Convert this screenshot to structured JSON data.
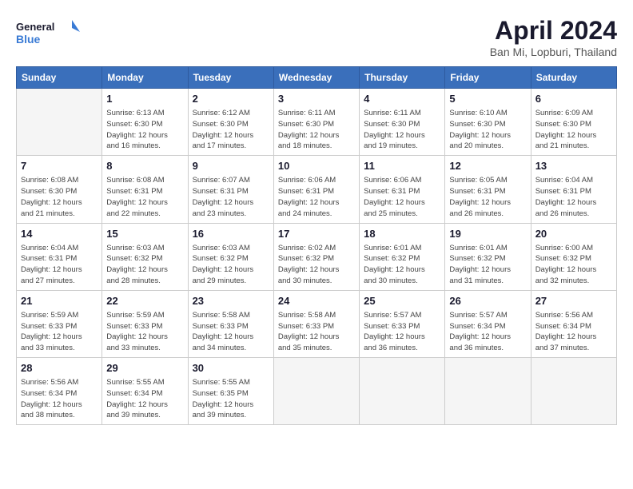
{
  "header": {
    "logo_line1": "General",
    "logo_line2": "Blue",
    "month_title": "April 2024",
    "location": "Ban Mi, Lopburi, Thailand"
  },
  "weekdays": [
    "Sunday",
    "Monday",
    "Tuesday",
    "Wednesday",
    "Thursday",
    "Friday",
    "Saturday"
  ],
  "weeks": [
    [
      {
        "day": "",
        "info": ""
      },
      {
        "day": "1",
        "info": "Sunrise: 6:13 AM\nSunset: 6:30 PM\nDaylight: 12 hours\nand 16 minutes."
      },
      {
        "day": "2",
        "info": "Sunrise: 6:12 AM\nSunset: 6:30 PM\nDaylight: 12 hours\nand 17 minutes."
      },
      {
        "day": "3",
        "info": "Sunrise: 6:11 AM\nSunset: 6:30 PM\nDaylight: 12 hours\nand 18 minutes."
      },
      {
        "day": "4",
        "info": "Sunrise: 6:11 AM\nSunset: 6:30 PM\nDaylight: 12 hours\nand 19 minutes."
      },
      {
        "day": "5",
        "info": "Sunrise: 6:10 AM\nSunset: 6:30 PM\nDaylight: 12 hours\nand 20 minutes."
      },
      {
        "day": "6",
        "info": "Sunrise: 6:09 AM\nSunset: 6:30 PM\nDaylight: 12 hours\nand 21 minutes."
      }
    ],
    [
      {
        "day": "7",
        "info": "Sunrise: 6:08 AM\nSunset: 6:30 PM\nDaylight: 12 hours\nand 21 minutes."
      },
      {
        "day": "8",
        "info": "Sunrise: 6:08 AM\nSunset: 6:31 PM\nDaylight: 12 hours\nand 22 minutes."
      },
      {
        "day": "9",
        "info": "Sunrise: 6:07 AM\nSunset: 6:31 PM\nDaylight: 12 hours\nand 23 minutes."
      },
      {
        "day": "10",
        "info": "Sunrise: 6:06 AM\nSunset: 6:31 PM\nDaylight: 12 hours\nand 24 minutes."
      },
      {
        "day": "11",
        "info": "Sunrise: 6:06 AM\nSunset: 6:31 PM\nDaylight: 12 hours\nand 25 minutes."
      },
      {
        "day": "12",
        "info": "Sunrise: 6:05 AM\nSunset: 6:31 PM\nDaylight: 12 hours\nand 26 minutes."
      },
      {
        "day": "13",
        "info": "Sunrise: 6:04 AM\nSunset: 6:31 PM\nDaylight: 12 hours\nand 26 minutes."
      }
    ],
    [
      {
        "day": "14",
        "info": "Sunrise: 6:04 AM\nSunset: 6:31 PM\nDaylight: 12 hours\nand 27 minutes."
      },
      {
        "day": "15",
        "info": "Sunrise: 6:03 AM\nSunset: 6:32 PM\nDaylight: 12 hours\nand 28 minutes."
      },
      {
        "day": "16",
        "info": "Sunrise: 6:03 AM\nSunset: 6:32 PM\nDaylight: 12 hours\nand 29 minutes."
      },
      {
        "day": "17",
        "info": "Sunrise: 6:02 AM\nSunset: 6:32 PM\nDaylight: 12 hours\nand 30 minutes."
      },
      {
        "day": "18",
        "info": "Sunrise: 6:01 AM\nSunset: 6:32 PM\nDaylight: 12 hours\nand 30 minutes."
      },
      {
        "day": "19",
        "info": "Sunrise: 6:01 AM\nSunset: 6:32 PM\nDaylight: 12 hours\nand 31 minutes."
      },
      {
        "day": "20",
        "info": "Sunrise: 6:00 AM\nSunset: 6:32 PM\nDaylight: 12 hours\nand 32 minutes."
      }
    ],
    [
      {
        "day": "21",
        "info": "Sunrise: 5:59 AM\nSunset: 6:33 PM\nDaylight: 12 hours\nand 33 minutes."
      },
      {
        "day": "22",
        "info": "Sunrise: 5:59 AM\nSunset: 6:33 PM\nDaylight: 12 hours\nand 33 minutes."
      },
      {
        "day": "23",
        "info": "Sunrise: 5:58 AM\nSunset: 6:33 PM\nDaylight: 12 hours\nand 34 minutes."
      },
      {
        "day": "24",
        "info": "Sunrise: 5:58 AM\nSunset: 6:33 PM\nDaylight: 12 hours\nand 35 minutes."
      },
      {
        "day": "25",
        "info": "Sunrise: 5:57 AM\nSunset: 6:33 PM\nDaylight: 12 hours\nand 36 minutes."
      },
      {
        "day": "26",
        "info": "Sunrise: 5:57 AM\nSunset: 6:34 PM\nDaylight: 12 hours\nand 36 minutes."
      },
      {
        "day": "27",
        "info": "Sunrise: 5:56 AM\nSunset: 6:34 PM\nDaylight: 12 hours\nand 37 minutes."
      }
    ],
    [
      {
        "day": "28",
        "info": "Sunrise: 5:56 AM\nSunset: 6:34 PM\nDaylight: 12 hours\nand 38 minutes."
      },
      {
        "day": "29",
        "info": "Sunrise: 5:55 AM\nSunset: 6:34 PM\nDaylight: 12 hours\nand 39 minutes."
      },
      {
        "day": "30",
        "info": "Sunrise: 5:55 AM\nSunset: 6:35 PM\nDaylight: 12 hours\nand 39 minutes."
      },
      {
        "day": "",
        "info": ""
      },
      {
        "day": "",
        "info": ""
      },
      {
        "day": "",
        "info": ""
      },
      {
        "day": "",
        "info": ""
      }
    ]
  ]
}
